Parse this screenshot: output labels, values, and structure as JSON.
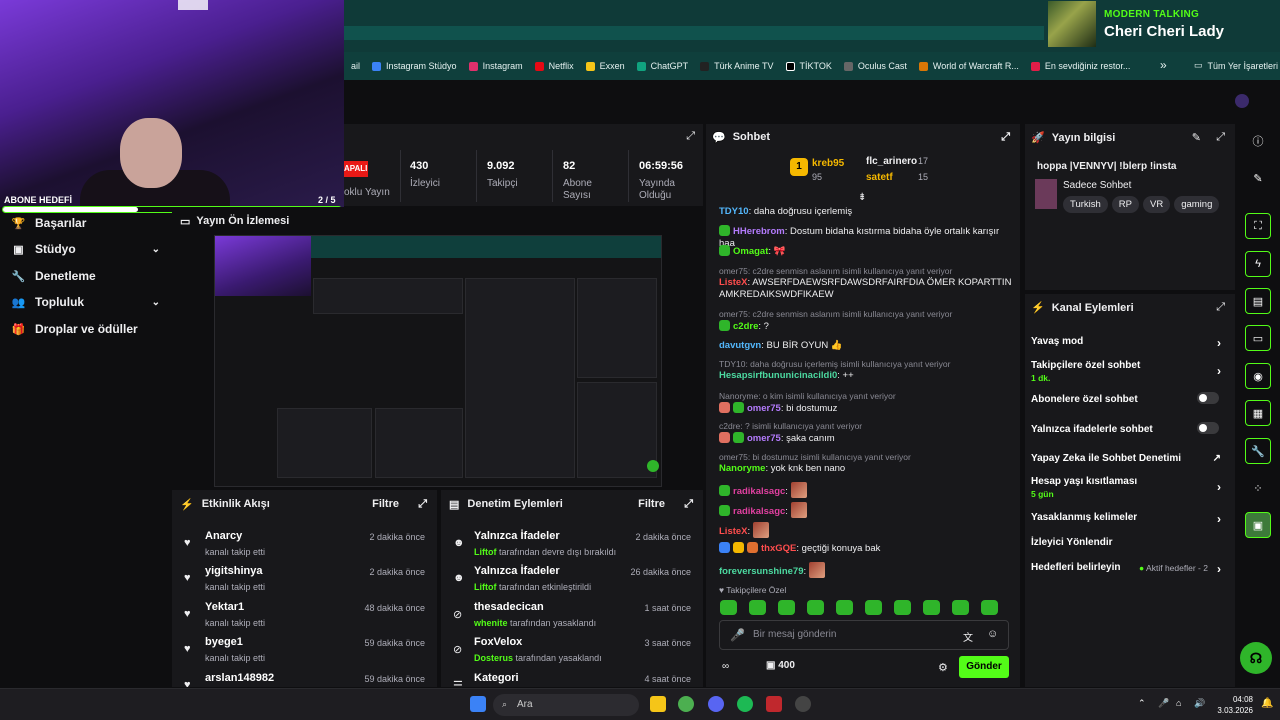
{
  "now_playing": {
    "artist": "MODERN TALKING",
    "title": "Cheri Cheri Lady"
  },
  "bookmarks": {
    "items": [
      "ail",
      "Instagram Stüdyo",
      "Instagram",
      "Netflix",
      "Exxen",
      "ChatGPT",
      "Türk Anime TV",
      "TİKTOK",
      "Oculus Cast",
      "World of Warcraft R...",
      "En sevdiğiniz restor..."
    ],
    "more": "»",
    "all": "Tüm Yer İşaretleri"
  },
  "goal": {
    "label": "ABONE HEDEFİ",
    "count": "2 / 5",
    "progress": 0.4
  },
  "nav": {
    "items": [
      {
        "label": "Başarılar"
      },
      {
        "label": "Stüdyo"
      },
      {
        "label": "Denetleme"
      },
      {
        "label": "Topluluk"
      },
      {
        "label": "Droplar ve ödüller"
      }
    ]
  },
  "stats": {
    "status": "APALI",
    "partial1": "oklu Yayın",
    "partial2": "Gelir",
    "items": [
      {
        "value": "430",
        "label": "İzleyici"
      },
      {
        "value": "9.092",
        "label": "Takipçi"
      },
      {
        "value": "82",
        "label": "Abone Sayısı"
      },
      {
        "value": "06:59:56",
        "label": "Yayında Olduğu"
      }
    ]
  },
  "preview": {
    "title": "Yayın Ön İzlemesi"
  },
  "activity": {
    "title": "Etkinlik Akışı",
    "filter": "Filtre",
    "rows": [
      {
        "name": "Anarcy",
        "sub": "kanalı takip etti",
        "time": "2 dakika önce"
      },
      {
        "name": "yigitshinya",
        "sub": "kanalı takip etti",
        "time": "2 dakika önce"
      },
      {
        "name": "Yektar1",
        "sub": "kanalı takip etti",
        "time": "48 dakika önce"
      },
      {
        "name": "byege1",
        "sub": "kanalı takip etti",
        "time": "59 dakika önce"
      },
      {
        "name": "arslan148982",
        "sub": "",
        "time": "59 dakika önce"
      }
    ]
  },
  "moderation": {
    "title": "Denetim Eylemleri",
    "filter": "Filtre",
    "rows": [
      {
        "name": "Yalnızca İfadeler",
        "user": "Liftof",
        "sub": "tarafından devre dışı bırakıldı",
        "time": "2 dakika önce"
      },
      {
        "name": "Yalnızca İfadeler",
        "user": "Liftof",
        "sub": "tarafından etkinleştirildi",
        "time": "26 dakika önce"
      },
      {
        "name": "thesadecican",
        "user": "whenite",
        "sub": "tarafından yasaklandı",
        "time": "1 saat önce"
      },
      {
        "name": "FoxVelox",
        "user": "Dosterus",
        "sub": "tarafından yasaklandı",
        "time": "3 saat önce"
      },
      {
        "name": "Kategori",
        "user": "",
        "sub": "",
        "time": "4 saat önce"
      }
    ]
  },
  "chat": {
    "title": "Sohbet",
    "leaders": [
      {
        "rank": "1",
        "name": "kreb95",
        "count": "95"
      },
      {
        "name": "flc_arinero",
        "count": "17"
      },
      {
        "name": "satetf",
        "count": "15"
      }
    ],
    "messages": [
      {
        "user": "TDY10",
        "text": "daha doğrusu içerlemiş"
      },
      {
        "user": "HHerebrom",
        "text": "Dostum bidaha kıstırma bidaha öyle ortalık karışır haa"
      },
      {
        "user": "Omagat",
        "text": ""
      },
      {
        "reply": "omer75: c2dre senmisn aslanım isimli kullanıcıya yanıt veriyor",
        "user": "ListeX",
        "text": "AWSERFDAEWSRFDAWSDRFAIRFDIA ÖMER KOPARTTIN AMKREDAIKSWDFIKAEW"
      },
      {
        "reply": "omer75: c2dre senmisn aslanım isimli kullanıcıya yanıt veriyor",
        "user": "c2dre",
        "text": "?"
      },
      {
        "user": "davutgvn",
        "text": "BU BİR OYUN"
      },
      {
        "reply": "TDY10: daha doğrusu içerlemiş isimli kullanıcıya yanıt veriyor",
        "user": "Hesapsirfbununicinacildi0",
        "text": "++"
      },
      {
        "reply": "Nanoryme: o kim isimli kullanıcıya yanıt veriyor",
        "user": "omer75",
        "text": "bi dostumuz"
      },
      {
        "reply": "c2dre: ? isimli kullanıcıya yanıt veriyor",
        "user": "omer75",
        "text": "şaka canım"
      },
      {
        "reply": "omer75: bi dostumuz isimli kullanıcıya yanıt veriyor",
        "user": "Nanoryme",
        "text": "yok knk ben nano"
      },
      {
        "user": "radikalsagc",
        "text": ""
      },
      {
        "user": "radikalsagc",
        "text": ""
      },
      {
        "user": "ListeX",
        "text": ""
      },
      {
        "user": "thxGQE",
        "text": "geçtiği konuya bak"
      },
      {
        "user": "foreversunshine79",
        "text": ""
      }
    ],
    "followers_only": "Takipçilere Özel",
    "placeholder": "Bir mesaj gönderin",
    "points": "400",
    "send": "Gönder"
  },
  "stream_info": {
    "title": "Yayın bilgisi",
    "stream_title": "hoppa |VENNYV| !blerp !insta",
    "category": "Sadece Sohbet",
    "tags": [
      "Turkish",
      "RP",
      "VR",
      "gaming"
    ]
  },
  "channel_actions": {
    "title": "Kanal Eylemleri",
    "items": [
      {
        "label": "Yavaş mod",
        "sub": ""
      },
      {
        "label": "Takipçilere özel sohbet",
        "sub": "1 dk."
      },
      {
        "label": "Abonelere özel sohbet",
        "sub": ""
      },
      {
        "label": "Yalnızca ifadelerle sohbet",
        "sub": ""
      },
      {
        "label": "Yapay Zeka ile Sohbet Denetimi",
        "sub": ""
      },
      {
        "label": "Hesap yaşı kısıtlaması",
        "sub": "5 gün"
      },
      {
        "label": "Yasaklanmış kelimeler",
        "sub": ""
      },
      {
        "label": "İzleyici Yönlendir",
        "sub": ""
      },
      {
        "label": "Hedefleri belirleyin",
        "sub": "Aktif hedefler - 2"
      }
    ]
  },
  "taskbar": {
    "search": "Ara",
    "time": "04:08",
    "date": "3.03.2026"
  },
  "colors": {
    "accent": "#53fc18",
    "panel": "#18181b",
    "bg": "#0e0e10",
    "browser": "#0f3f3c"
  }
}
